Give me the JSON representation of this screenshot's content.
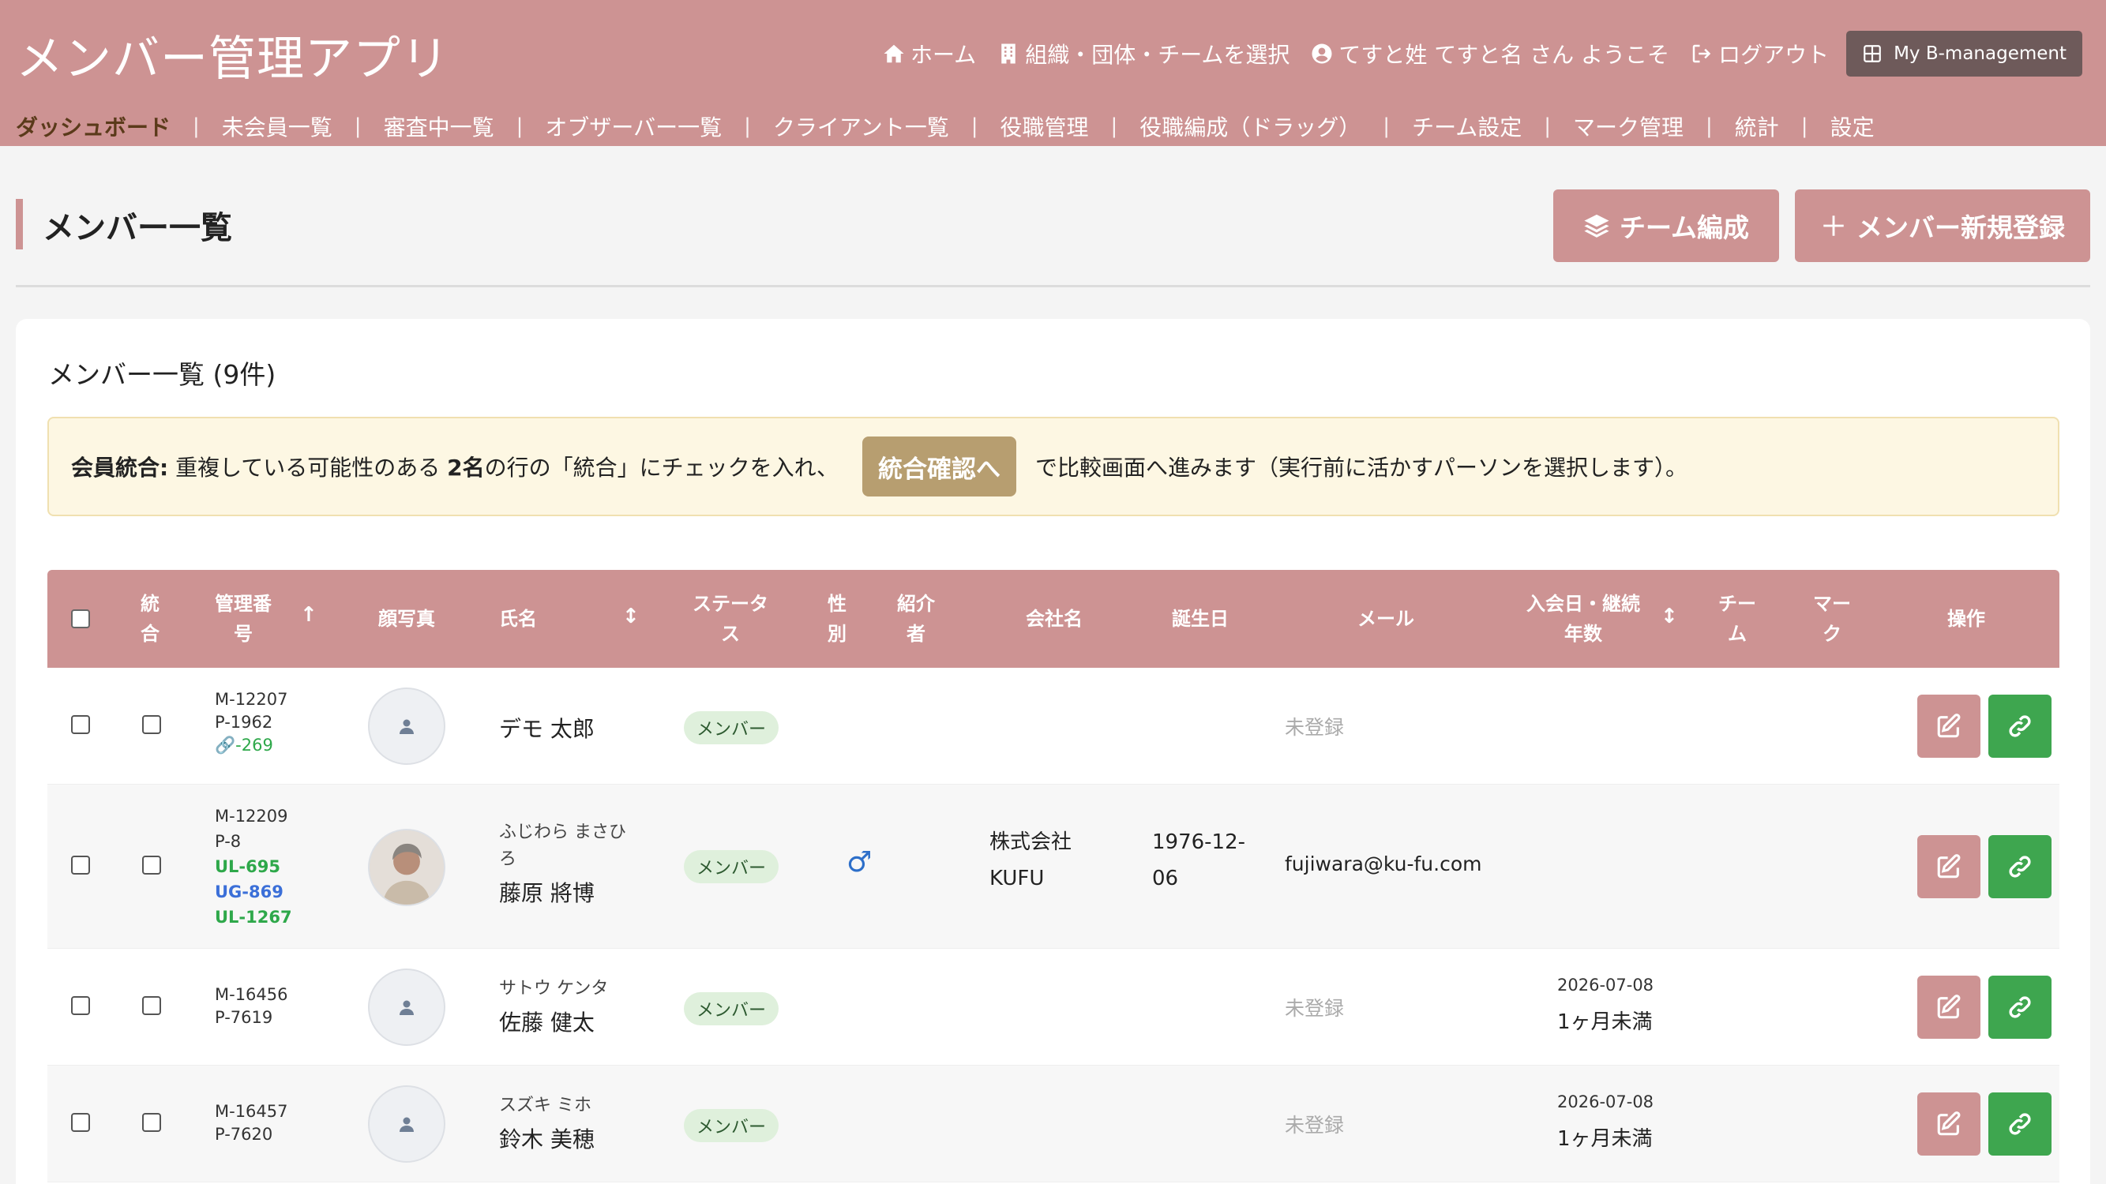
{
  "app": {
    "title": "メンバー管理アプリ"
  },
  "top_links": {
    "home": "ホーム",
    "select_org": "組織・団体・チームを選択",
    "welcome": "てすと姓 てすと名 さん ようこそ",
    "logout": "ログアウト",
    "my_button": "My B-management"
  },
  "nav": {
    "items": [
      "ダッシュボード",
      "未会員一覧",
      "審査中一覧",
      "オブザーバー一覧",
      "クライアント一覧",
      "役職管理",
      "役職編成（ドラッグ）",
      "チーム設定",
      "マーク管理",
      "統計",
      "設定"
    ],
    "separator": "|"
  },
  "page": {
    "title": "メンバー一覧",
    "team_button": "チーム編成",
    "new_button": "メンバー新規登録"
  },
  "card": {
    "title": "メンバー一覧 (9件)"
  },
  "notice": {
    "label": "会員統合:",
    "text1": " 重複している可能性のある ",
    "count": "2名",
    "text2": " の行の「統合」にチェックを入れ、",
    "button": "統合確認へ",
    "text3": "で比較画面へ進みます（実行前に活かすパーソンを選択します）。"
  },
  "table": {
    "headers": {
      "merge": "統\n合",
      "id": "管理番\n号",
      "photo": "顔写真",
      "name": "氏名",
      "status": "ステータ\nス",
      "gender": "性\n別",
      "referrer": "紹介\n者",
      "company": "会社名",
      "birthday": "誕生日",
      "email": "メール",
      "joined": "入会日・継続\n年数",
      "team": "チー\nム",
      "mark": "マー\nク",
      "actions": "操作"
    },
    "sort_asc": "↑",
    "sort_both": "↕",
    "rows": [
      {
        "id1": "M-12207",
        "id2": "P-1962",
        "link_id": "-269",
        "name": "デモ 太郎",
        "status": "メンバー",
        "email": "未登録"
      },
      {
        "id1": "M-12209",
        "id2": "P-8",
        "tag1": "UL-695",
        "tag2": "UG-869",
        "tag3": "UL-1267",
        "kana": "ふじわら まさひ\nろ",
        "name": "藤原 將博",
        "status": "メンバー",
        "gender": "♂",
        "company": "株式会社\nKUFU",
        "birthday": "1976-12-\n06",
        "email": "fujiwara@ku-fu.com"
      },
      {
        "id1": "M-16456",
        "id2": "P-7619",
        "kana": "サトウ ケンタ",
        "name": "佐藤 健太",
        "status": "メンバー",
        "email": "未登録",
        "joined_date": "2026-07-08",
        "joined_years": "1ヶ月未満"
      },
      {
        "id1": "M-16457",
        "id2": "P-7620",
        "kana": "スズキ ミホ",
        "name": "鈴木 美穂",
        "status": "メンバー",
        "email": "未登録",
        "joined_date": "2026-07-08",
        "joined_years": "1ヶ月未満"
      }
    ]
  },
  "colors": {
    "primary": "#cd9393",
    "merge_button": "#b79e70",
    "link_button": "#3ea64f",
    "badge_bg": "#dff0dc"
  },
  "icons": [
    "home-icon",
    "building-icon",
    "user-circle-icon",
    "logout-icon",
    "grid-icon",
    "layers-icon",
    "plus-icon",
    "edit-icon",
    "link-icon",
    "person-icon"
  ]
}
